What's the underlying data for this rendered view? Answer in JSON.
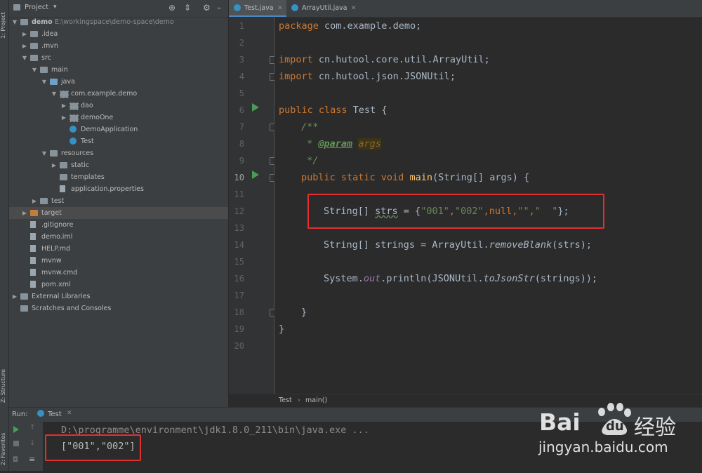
{
  "side_tabs": {
    "project": "1: Project",
    "structure": "Z: Structure",
    "favorites": "2: Favorites"
  },
  "project_panel": {
    "title": "Project",
    "tree": [
      {
        "label": "demo",
        "extra": "E:\\workingspace\\demo-space\\demo",
        "indent": 0,
        "expanded": true,
        "icon": "folder"
      },
      {
        "label": ".idea",
        "indent": 1,
        "expanded": false,
        "icon": "folder"
      },
      {
        "label": ".mvn",
        "indent": 1,
        "expanded": false,
        "icon": "folder"
      },
      {
        "label": "src",
        "indent": 1,
        "expanded": true,
        "icon": "folder"
      },
      {
        "label": "main",
        "indent": 2,
        "expanded": true,
        "icon": "folder"
      },
      {
        "label": "java",
        "indent": 3,
        "expanded": true,
        "icon": "folder-blue"
      },
      {
        "label": "com.example.demo",
        "indent": 4,
        "expanded": true,
        "icon": "package"
      },
      {
        "label": "dao",
        "indent": 5,
        "expanded": false,
        "icon": "package"
      },
      {
        "label": "demoOne",
        "indent": 5,
        "expanded": false,
        "icon": "package"
      },
      {
        "label": "DemoApplication",
        "indent": 5,
        "icon": "class"
      },
      {
        "label": "Test",
        "indent": 5,
        "icon": "class"
      },
      {
        "label": "resources",
        "indent": 3,
        "expanded": true,
        "icon": "folder"
      },
      {
        "label": "static",
        "indent": 4,
        "expanded": false,
        "icon": "folder"
      },
      {
        "label": "templates",
        "indent": 4,
        "icon": "folder"
      },
      {
        "label": "application.properties",
        "indent": 4,
        "icon": "file"
      },
      {
        "label": "test",
        "indent": 2,
        "expanded": false,
        "icon": "folder"
      },
      {
        "label": "target",
        "indent": 1,
        "expanded": false,
        "icon": "folder-orange",
        "selected": true
      },
      {
        "label": ".gitignore",
        "indent": 1,
        "icon": "file"
      },
      {
        "label": "demo.iml",
        "indent": 1,
        "icon": "file"
      },
      {
        "label": "HELP.md",
        "indent": 1,
        "icon": "file"
      },
      {
        "label": "mvnw",
        "indent": 1,
        "icon": "file"
      },
      {
        "label": "mvnw.cmd",
        "indent": 1,
        "icon": "file"
      },
      {
        "label": "pom.xml",
        "indent": 1,
        "icon": "file"
      },
      {
        "label": "External Libraries",
        "indent": 0,
        "expanded": false,
        "icon": "folder"
      },
      {
        "label": "Scratches and Consoles",
        "indent": 0,
        "icon": "folder"
      }
    ]
  },
  "editor": {
    "tabs": [
      {
        "label": "Test.java",
        "active": true
      },
      {
        "label": "ArrayUtil.java",
        "active": false
      }
    ],
    "line_numbers": [
      "1",
      "2",
      "3",
      "4",
      "5",
      "6",
      "7",
      "8",
      "9",
      "10",
      "11",
      "12",
      "13",
      "14",
      "15",
      "16",
      "17",
      "18",
      "19",
      "20"
    ],
    "code": {
      "l1_kw": "package",
      "l1_rest": " com.example.demo;",
      "l3_kw": "import",
      "l3_rest": " cn.hutool.core.util.ArrayUtil;",
      "l4_kw": "import",
      "l4_rest": " cn.hutool.json.JSONUtil;",
      "l6_kw": "public class",
      "l6_rest": " Test {",
      "l7": "/**",
      "l8_star": " * ",
      "l8_tag": "@param",
      "l8_sp": " ",
      "l8_arg": "args",
      "l9": " */",
      "l10_kw": "public static void",
      "l10_sp": " ",
      "l10_fn": "main",
      "l10_rest": "(String[] args) {",
      "l12_a": "String[] ",
      "l12_var": "strs",
      "l12_b": " = {",
      "l12_s1": "\"001\"",
      "l12_c1": ",",
      "l12_s2": "\"002\"",
      "l12_c2": ",",
      "l12_null": "null",
      "l12_c3": ",",
      "l12_s3": "\"\"",
      "l12_c4": ",",
      "l12_s4": "\"  \"",
      "l12_end": "};",
      "l14_a": "String[] strings = ArrayUtil.",
      "l14_fn": "removeBlank",
      "l14_b": "(strs);",
      "l16_a": "System.",
      "l16_out": "out",
      "l16_b": ".println(JSONUtil.",
      "l16_fn": "toJsonStr",
      "l16_c": "(strings));",
      "l18": "}",
      "l19": "}"
    },
    "breadcrumb": [
      "Test",
      "main()"
    ]
  },
  "run_panel": {
    "label": "Run:",
    "tab": "Test",
    "console": [
      "D:\\programme\\environment\\jdk1.8.0_211\\bin\\java.exe ...",
      "[\"001\",\"002\"]"
    ]
  },
  "watermark": {
    "brand": "Bai",
    "brand2": "du",
    "cn": "经验",
    "url": "jingyan.baidu.com"
  }
}
